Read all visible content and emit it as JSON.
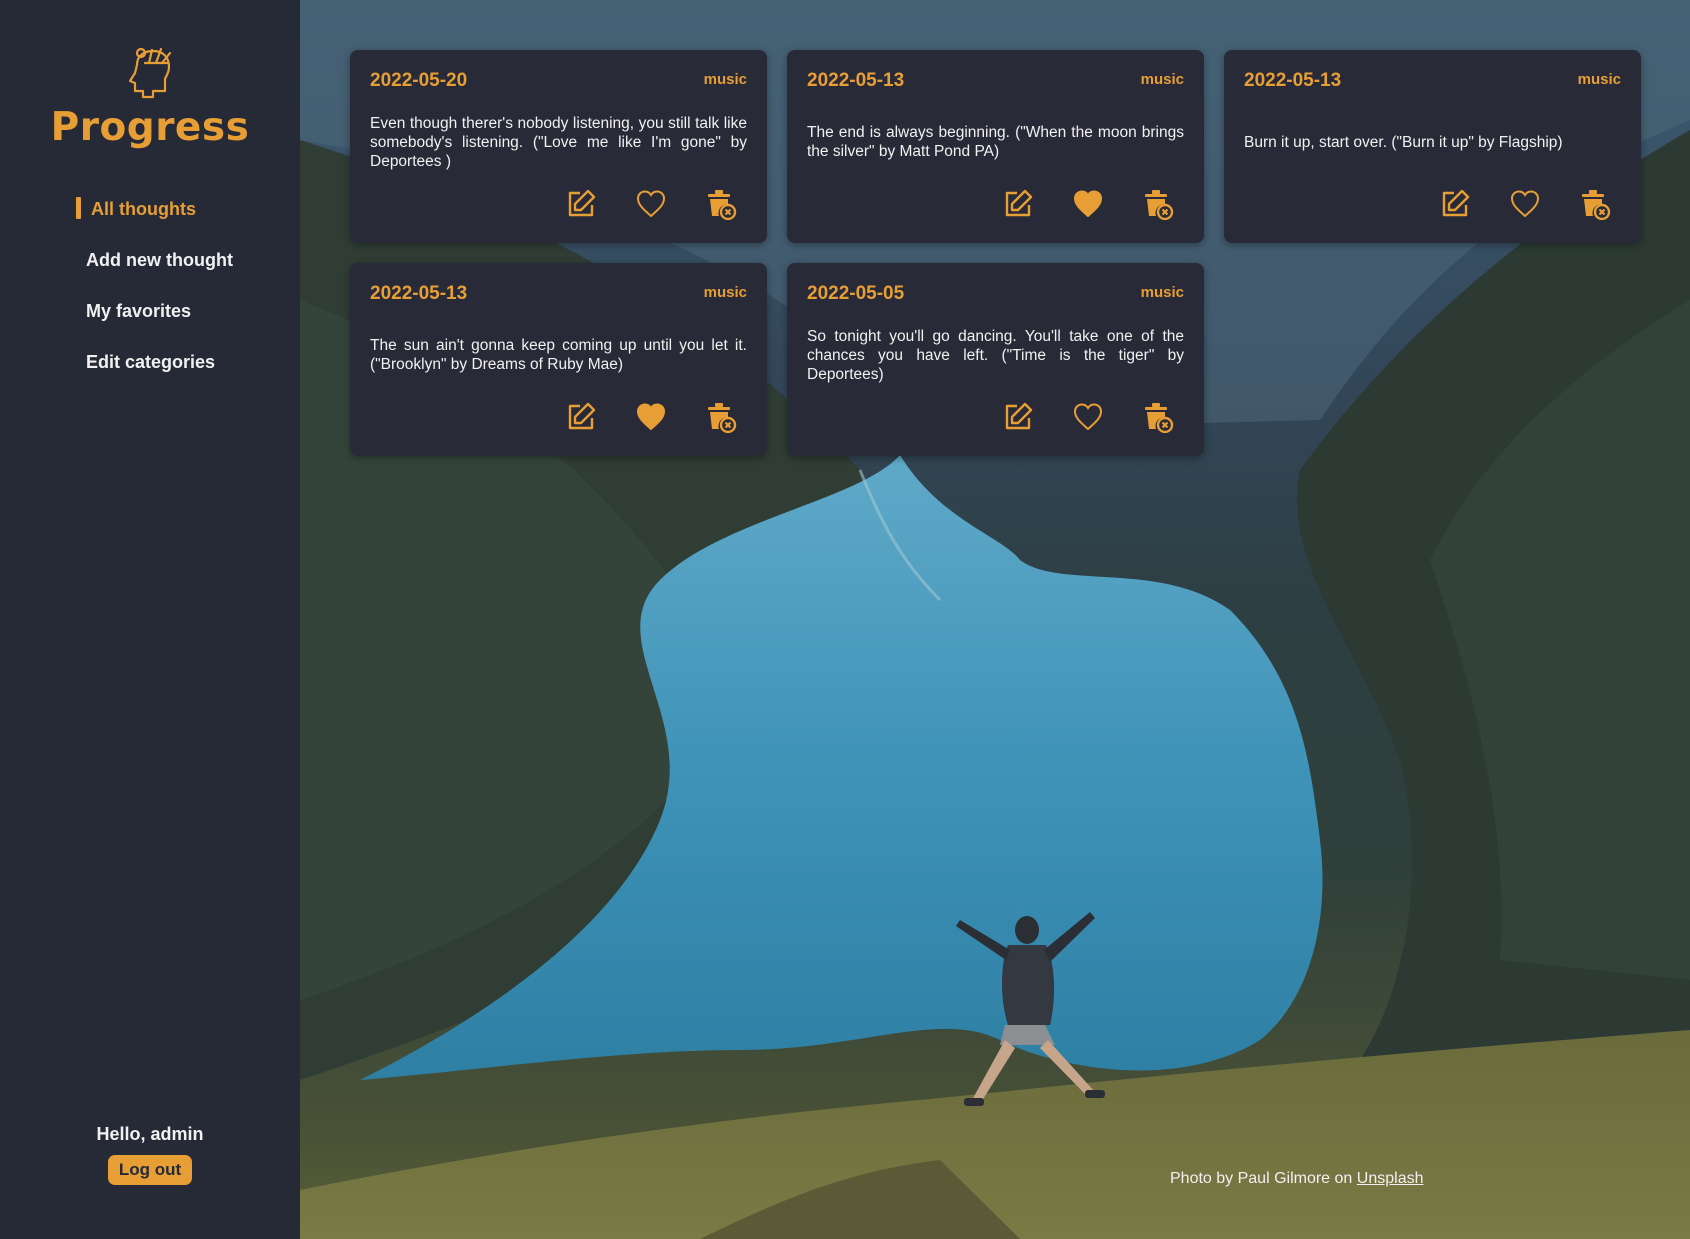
{
  "app": {
    "name": "Progress"
  },
  "nav": {
    "items": [
      {
        "label": "All thoughts",
        "active": true
      },
      {
        "label": "Add new thought",
        "active": false
      },
      {
        "label": "My favorites",
        "active": false
      },
      {
        "label": "Edit categories",
        "active": false
      }
    ]
  },
  "user": {
    "greeting": "Hello, admin",
    "logout_label": "Log out"
  },
  "thoughts": [
    {
      "date": "2022-05-20",
      "category": "music",
      "text": "Even though therer's nobody listening, you still talk like somebody's listening. (\"Love me like I'm gone\" by Deportees )",
      "favorite": false
    },
    {
      "date": "2022-05-13",
      "category": "music",
      "text": "The end is always beginning. (\"When the moon brings the silver\" by Matt Pond PA)",
      "favorite": true
    },
    {
      "date": "2022-05-13",
      "category": "music",
      "text": "Burn it up, start over. (\"Burn it up\" by Flagship)",
      "favorite": false
    },
    {
      "date": "2022-05-13",
      "category": "music",
      "text": "The sun ain't gonna keep coming up until you let it. (\"Brooklyn\" by Dreams of Ruby Mae)",
      "favorite": true
    },
    {
      "date": "2022-05-05",
      "category": "music",
      "text": "So tonight you'll go dancing. You'll take one of the chances you have left. (\"Time is the tiger\" by Deportees)",
      "favorite": false
    }
  ],
  "credit": {
    "prefix": "Photo by Paul Gilmore on",
    "link_label": "Unsplash"
  },
  "icons": {
    "edit": "edit-icon",
    "favorite": "heart-icon",
    "delete": "trash-icon"
  },
  "colors": {
    "accent": "#e79f35",
    "sidebar": "#262936",
    "card": "#282a37",
    "text": "#f1f1f1"
  }
}
